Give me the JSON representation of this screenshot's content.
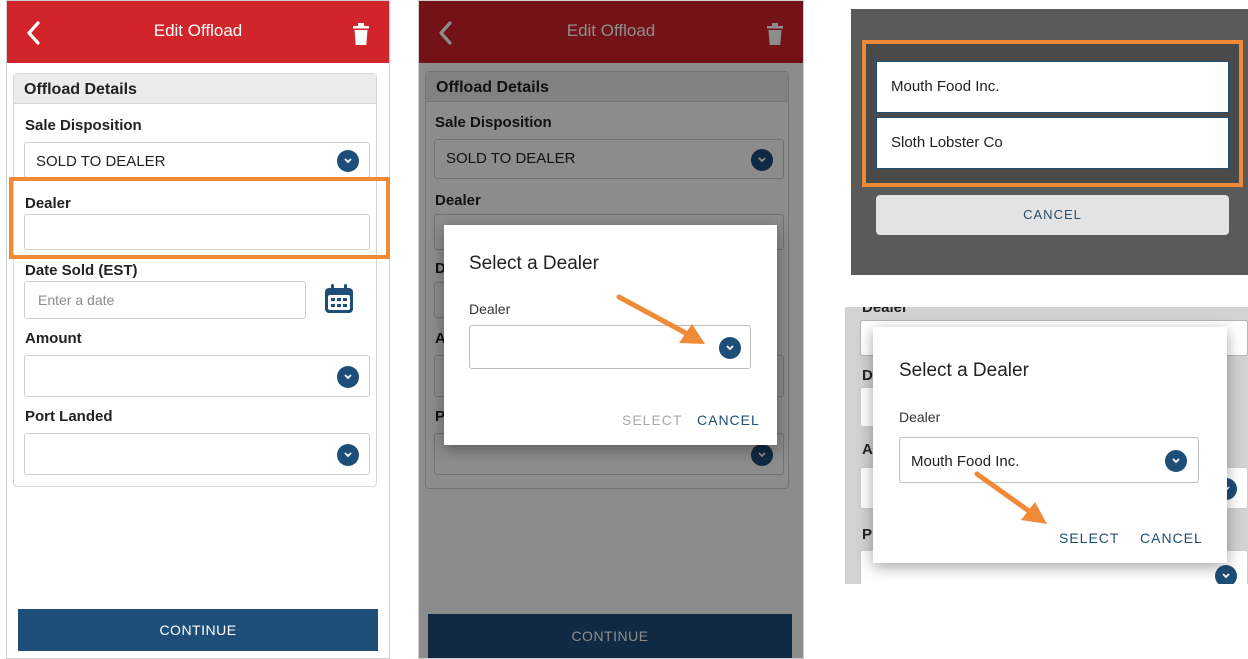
{
  "panel1": {
    "header_title": "Edit Offload",
    "section_title": "Offload Details",
    "sale_disposition_label": "Sale Disposition",
    "sale_disposition_value": "SOLD TO DEALER",
    "dealer_label": "Dealer",
    "dealer_value": "",
    "date_sold_label": "Date Sold (EST)",
    "date_sold_placeholder": "Enter a date",
    "amount_label": "Amount",
    "amount_value": "",
    "port_landed_label": "Port Landed",
    "port_landed_value": "",
    "continue_label": "CONTINUE"
  },
  "panel2": {
    "header_title": "Edit Offload",
    "section_title": "Offload Details",
    "sale_disposition_label": "Sale Disposition",
    "sale_disposition_value": "SOLD TO DEALER",
    "dealer_label": "Dealer",
    "dialog_title": "Select a Dealer",
    "dialog_field_label": "Dealer",
    "dialog_field_value": "",
    "select_label": "SELECT",
    "cancel_label": "CANCEL",
    "continue_label": "CONTINUE",
    "hidden_labels": [
      "D",
      "A",
      "P"
    ]
  },
  "panel3": {
    "options": [
      "Mouth Food Inc.",
      "Sloth Lobster Co"
    ],
    "cancel_label": "CANCEL"
  },
  "panel4": {
    "top_cut_label": "Dealer",
    "dialog_title": "Select a Dealer",
    "dialog_field_label": "Dealer",
    "dialog_field_value": "Mouth Food Inc.",
    "select_label": "SELECT",
    "cancel_label": "CANCEL",
    "hidden_labels": [
      "D",
      "A",
      "P"
    ]
  },
  "colors": {
    "header_red": "#d2242b",
    "primary_blue": "#1d4e78",
    "highlight_orange": "#f08a36"
  },
  "icons": {
    "back": "chevron-left-icon",
    "delete": "trash-icon",
    "dropdown": "chevron-down-icon",
    "calendar": "calendar-icon",
    "pointer": "arrow-icon"
  }
}
